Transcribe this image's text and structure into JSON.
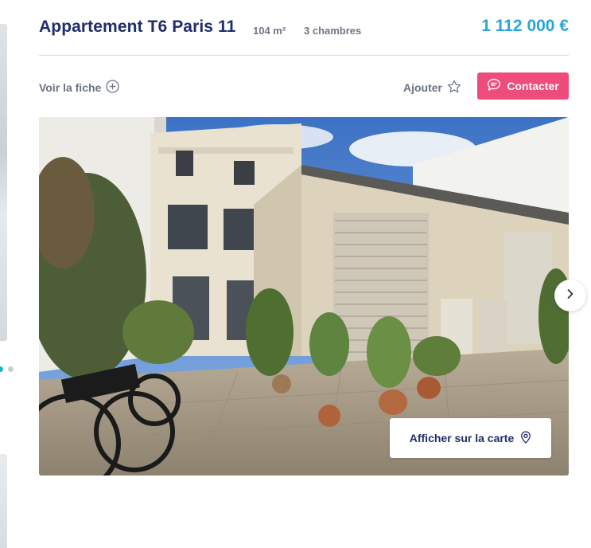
{
  "listing": {
    "title": "Appartement T6 Paris 11",
    "area": "104 m²",
    "rooms": "3 chambres",
    "price": "1 112 000 €"
  },
  "actions": {
    "view_sheet": "Voir la fiche",
    "add": "Ajouter",
    "contact": "Contacter"
  },
  "photo": {
    "map_button": "Afficher sur la carte"
  },
  "colors": {
    "title": "#1f2d6a",
    "price": "#2aa5dc",
    "contact_button": "#ee4c7b",
    "carousel_dot_active": "#1bb1d8"
  },
  "icons": {
    "view_sheet": "plus-circle-icon",
    "add": "star-icon",
    "contact": "chat-bubble-icon",
    "map": "map-pin-icon",
    "next": "chevron-right-icon"
  }
}
